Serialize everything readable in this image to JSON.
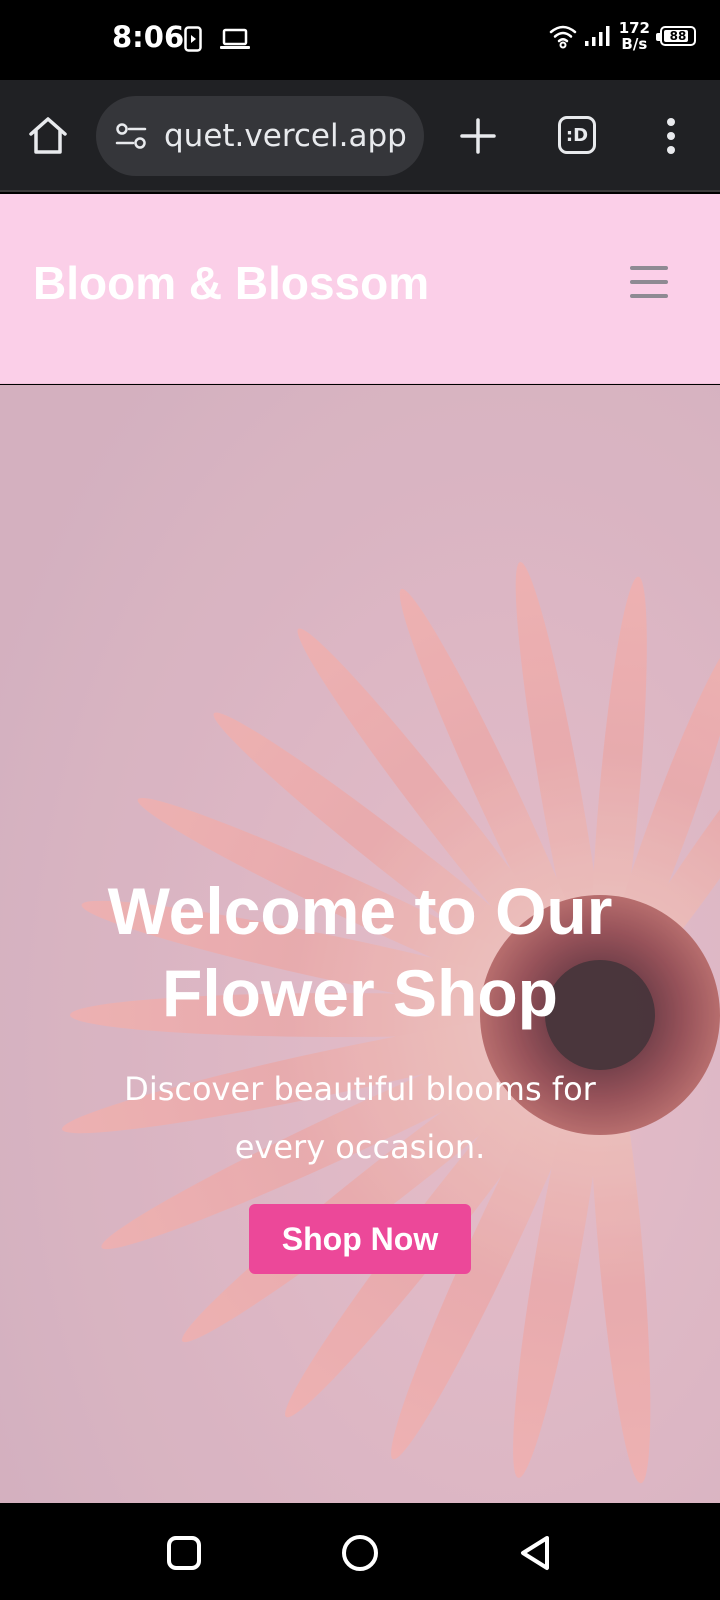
{
  "status_bar": {
    "time": "8:06",
    "net_speed_value": "172",
    "net_speed_unit": "B/s",
    "battery": "88",
    "battery_fraction": 0.88,
    "icons": [
      "screen-record-icon",
      "laptop-icon",
      "wifi-icon",
      "signal-icon",
      "battery-icon"
    ]
  },
  "browser": {
    "url": "quet.vercel.app",
    "tabs_label": ":D",
    "icons": [
      "home-icon",
      "site-info-icon",
      "plus-icon",
      "tabs-icon",
      "more-vert-icon"
    ]
  },
  "site": {
    "brand": "Bloom & Blossom",
    "header_color": "#fbcfe8",
    "hero": {
      "title": "Welcome to Our Flower Shop",
      "subtitle": "Discover beautiful blooms for every occasion.",
      "cta_label": "Shop Now",
      "cta_color": "#ec4899"
    }
  },
  "nav_bar": {
    "icons": [
      "recents-square-icon",
      "home-circle-icon",
      "back-triangle-icon"
    ]
  }
}
